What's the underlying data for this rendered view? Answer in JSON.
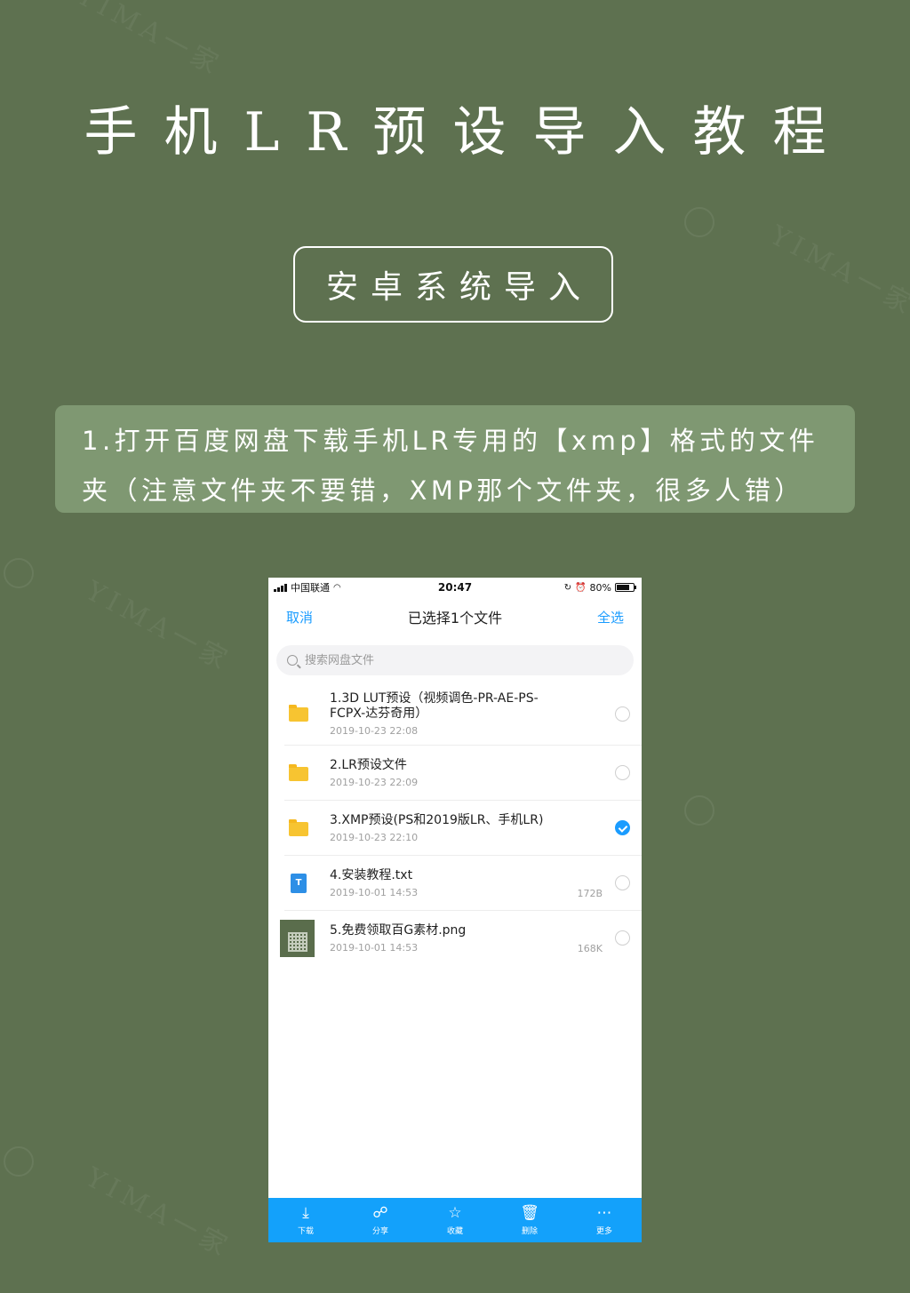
{
  "header": {
    "title": "手机LR预设导入教程",
    "section": "安卓系统导入"
  },
  "instruction": {
    "text": "1.打开百度网盘下载手机LR专用的【xmp】格式的文件夹（注意文件夹不要错，XMP那个文件夹，很多人错）"
  },
  "watermark": {
    "text": "YIMA一家"
  },
  "phone": {
    "status": {
      "carrier": "中国联通",
      "time": "20:47",
      "battery": "80%",
      "battery_level": 0.8
    },
    "nav": {
      "cancel": "取消",
      "title": "已选择1个文件",
      "select_all": "全选"
    },
    "search": {
      "placeholder": "搜索网盘文件"
    },
    "files": [
      {
        "name": "1.3D LUT预设（视频调色-PR-AE-PS-FCPX-达芬奇用）",
        "date": "2019-10-23 22:08",
        "size": "",
        "type": "folder",
        "checked": false
      },
      {
        "name": "2.LR预设文件",
        "date": "2019-10-23 22:09",
        "size": "",
        "type": "folder",
        "checked": false
      },
      {
        "name": "3.XMP预设(PS和2019版LR、手机LR)",
        "date": "2019-10-23 22:10",
        "size": "",
        "type": "folder",
        "checked": true
      },
      {
        "name": "4.安装教程.txt",
        "date": "2019-10-01 14:53",
        "size": "172B",
        "type": "txt",
        "checked": false
      },
      {
        "name": "5.免费领取百G素材.png",
        "date": "2019-10-01 14:53",
        "size": "168K",
        "type": "image",
        "checked": false
      }
    ],
    "toolbar": {
      "download": "下载",
      "share": "分享",
      "favorite": "收藏",
      "delete": "删除",
      "more": "更多"
    },
    "colors": {
      "accent": "#1a9cff",
      "toolbar": "#13a1fb",
      "folder": "#f7c431"
    }
  },
  "colors": {
    "background": "#5e7150",
    "instruction_bg": "#7f9872"
  }
}
